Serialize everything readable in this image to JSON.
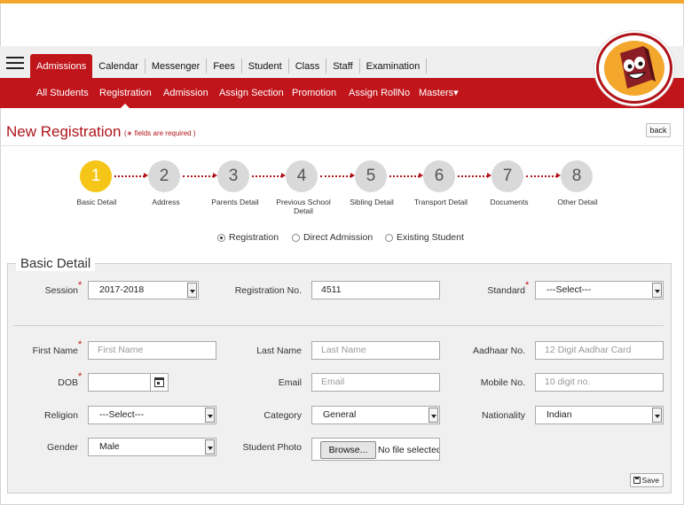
{
  "main_tabs": [
    "Admissions",
    "Calendar",
    "Messenger",
    "Fees",
    "Student",
    "Class",
    "Staff",
    "Examination"
  ],
  "sub_nav": [
    "All Students",
    "Registration",
    "Admission",
    "Assign Section",
    "Promotion",
    "Assign RollNo",
    "Masters"
  ],
  "sub_nav_dropdown_marker": "▾",
  "page": {
    "title": "New Registration",
    "required_prefix": "(",
    "required_star": "∗",
    "required_text": " fields are required )",
    "back_label": "back"
  },
  "steps": [
    {
      "number": "1",
      "label": "Basic Detail"
    },
    {
      "number": "2",
      "label": "Address"
    },
    {
      "number": "3",
      "label": "Parents Detail"
    },
    {
      "number": "4",
      "label": "Previous School Detail"
    },
    {
      "number": "5",
      "label": "Sibling Detail"
    },
    {
      "number": "6",
      "label": "Transport Detail"
    },
    {
      "number": "7",
      "label": "Documents"
    },
    {
      "number": "8",
      "label": "Other Detail"
    }
  ],
  "active_step": 1,
  "registration_types": [
    {
      "label": "Registration",
      "selected": true
    },
    {
      "label": "Direct Admission",
      "selected": false
    },
    {
      "label": "Existing Student",
      "selected": false
    }
  ],
  "form": {
    "legend": "Basic Detail",
    "session": {
      "label": "Session",
      "value": "2017-2018"
    },
    "registration_no": {
      "label": "Registration No.",
      "value": "4511"
    },
    "standard": {
      "label": "Standard",
      "value": "---Select---"
    },
    "first_name": {
      "label": "First Name",
      "placeholder": "First Name"
    },
    "last_name": {
      "label": "Last Name",
      "placeholder": "Last Name"
    },
    "aadhaar": {
      "label": "Aadhaar No.",
      "placeholder": "12 Digit Aadhar Card"
    },
    "dob": {
      "label": "DOB",
      "value": ""
    },
    "email": {
      "label": "Email",
      "placeholder": "Email"
    },
    "mobile": {
      "label": "Mobile No.",
      "placeholder": "10 digit no."
    },
    "religion": {
      "label": "Religion",
      "value": "---Select---"
    },
    "category": {
      "label": "Category",
      "value": "General"
    },
    "nationality": {
      "label": "Nationality",
      "value": "Indian"
    },
    "gender": {
      "label": "Gender",
      "value": "Male"
    },
    "student_photo": {
      "label": "Student Photo",
      "browse_label": "Browse...",
      "file_status": "No file selected."
    },
    "required_mark": "*",
    "save_label": "Save"
  },
  "colors": {
    "accent_red": "#c0151b",
    "accent_orange": "#f3a72c",
    "active_step": "#f5c518",
    "inactive_step": "#d9d9d9"
  },
  "icons": [
    "menu-icon",
    "mascot-logo",
    "calendar-icon",
    "save-icon",
    "dropdown-arrow-icon"
  ]
}
